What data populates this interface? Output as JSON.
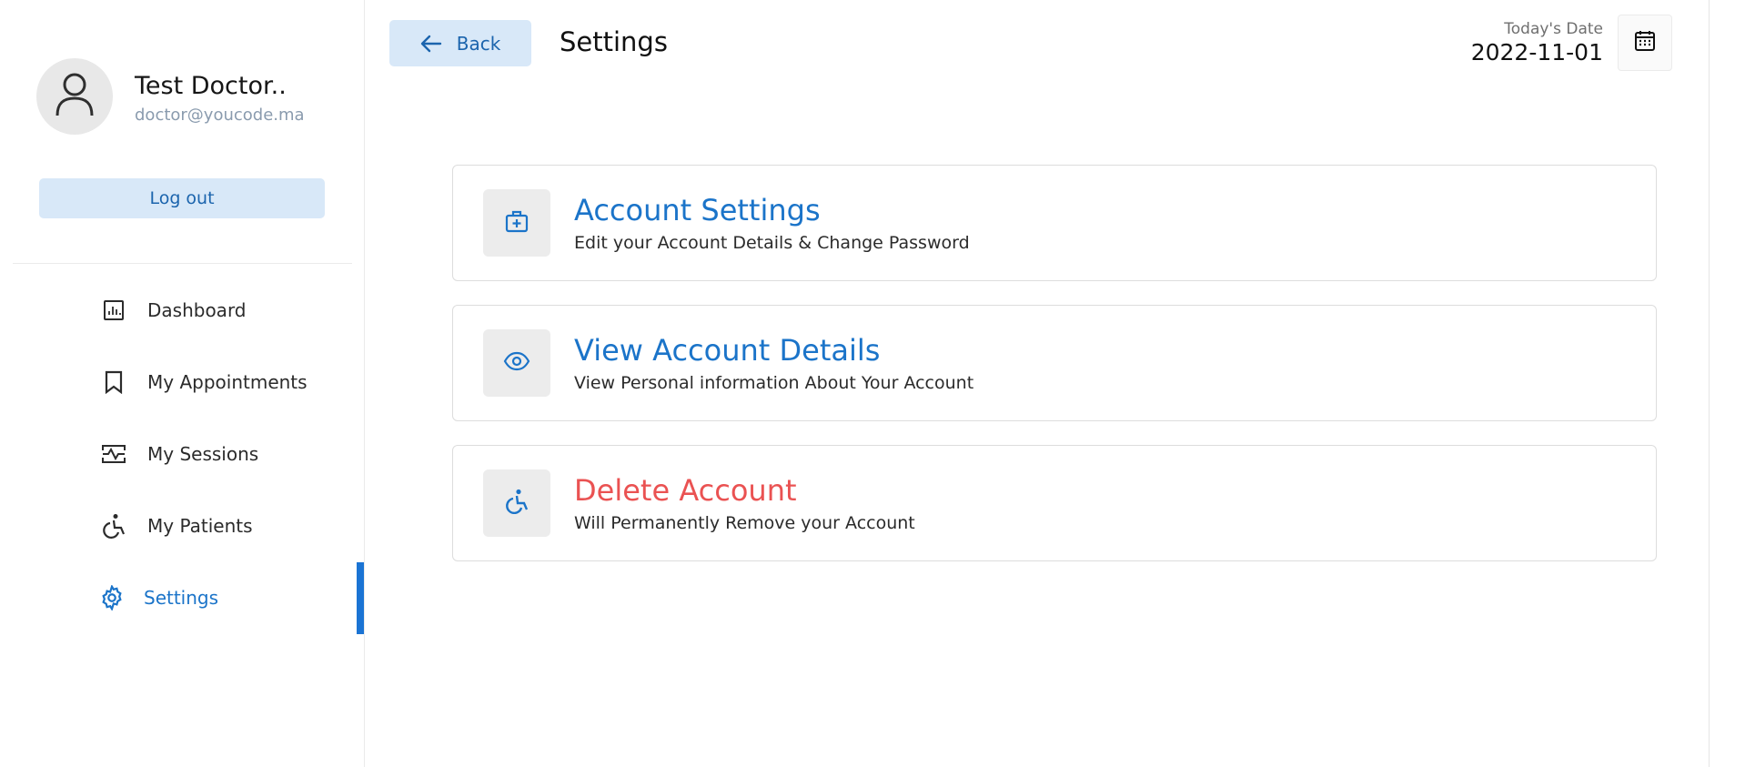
{
  "profile": {
    "name": "Test Doctor..",
    "email": "doctor@youcode.ma",
    "avatar_icon": "user-icon"
  },
  "sidebar": {
    "logout_label": "Log out",
    "items": [
      {
        "label": "Dashboard",
        "icon": "dashboard-icon",
        "active": false
      },
      {
        "label": "My Appointments",
        "icon": "bookmark-icon",
        "active": false
      },
      {
        "label": "My Sessions",
        "icon": "session-icon",
        "active": false
      },
      {
        "label": "My Patients",
        "icon": "patient-icon",
        "active": false
      },
      {
        "label": "Settings",
        "icon": "gear-icon",
        "active": true
      }
    ]
  },
  "header": {
    "back_label": "Back",
    "title": "Settings",
    "date_label": "Today's Date",
    "date_value": "2022-11-01"
  },
  "cards": [
    {
      "title": "Account Settings",
      "description": "Edit your Account Details & Change Password",
      "icon": "medical-briefcase-icon"
    },
    {
      "title": "View Account Details",
      "description": "View Personal information About Your Account",
      "icon": "eye-icon"
    },
    {
      "title": "Delete Account",
      "description": "Will Permanently Remove your Account",
      "icon": "accessible-icon"
    }
  ],
  "colors": {
    "accent": "#1b74c9",
    "accent_light": "#d8e8f8",
    "danger": "#ea5252",
    "muted_text": "#8a9bae"
  }
}
